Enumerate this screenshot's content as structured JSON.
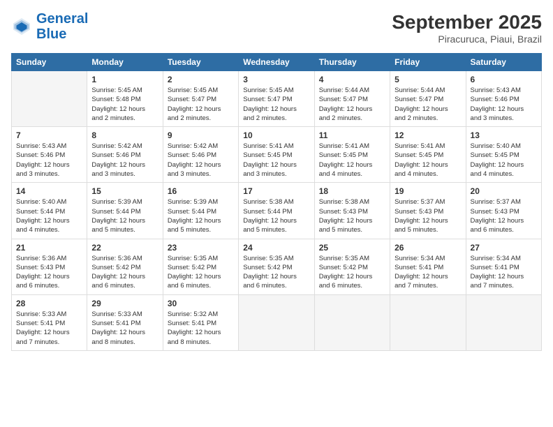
{
  "header": {
    "logo_line1": "General",
    "logo_line2": "Blue",
    "title": "September 2025",
    "subtitle": "Piracuruca, Piaui, Brazil"
  },
  "weekdays": [
    "Sunday",
    "Monday",
    "Tuesday",
    "Wednesday",
    "Thursday",
    "Friday",
    "Saturday"
  ],
  "weeks": [
    [
      {
        "day": "",
        "info": ""
      },
      {
        "day": "1",
        "info": "Sunrise: 5:45 AM\nSunset: 5:48 PM\nDaylight: 12 hours\nand 2 minutes."
      },
      {
        "day": "2",
        "info": "Sunrise: 5:45 AM\nSunset: 5:47 PM\nDaylight: 12 hours\nand 2 minutes."
      },
      {
        "day": "3",
        "info": "Sunrise: 5:45 AM\nSunset: 5:47 PM\nDaylight: 12 hours\nand 2 minutes."
      },
      {
        "day": "4",
        "info": "Sunrise: 5:44 AM\nSunset: 5:47 PM\nDaylight: 12 hours\nand 2 minutes."
      },
      {
        "day": "5",
        "info": "Sunrise: 5:44 AM\nSunset: 5:47 PM\nDaylight: 12 hours\nand 2 minutes."
      },
      {
        "day": "6",
        "info": "Sunrise: 5:43 AM\nSunset: 5:46 PM\nDaylight: 12 hours\nand 3 minutes."
      }
    ],
    [
      {
        "day": "7",
        "info": "Sunrise: 5:43 AM\nSunset: 5:46 PM\nDaylight: 12 hours\nand 3 minutes."
      },
      {
        "day": "8",
        "info": "Sunrise: 5:42 AM\nSunset: 5:46 PM\nDaylight: 12 hours\nand 3 minutes."
      },
      {
        "day": "9",
        "info": "Sunrise: 5:42 AM\nSunset: 5:46 PM\nDaylight: 12 hours\nand 3 minutes."
      },
      {
        "day": "10",
        "info": "Sunrise: 5:41 AM\nSunset: 5:45 PM\nDaylight: 12 hours\nand 3 minutes."
      },
      {
        "day": "11",
        "info": "Sunrise: 5:41 AM\nSunset: 5:45 PM\nDaylight: 12 hours\nand 4 minutes."
      },
      {
        "day": "12",
        "info": "Sunrise: 5:41 AM\nSunset: 5:45 PM\nDaylight: 12 hours\nand 4 minutes."
      },
      {
        "day": "13",
        "info": "Sunrise: 5:40 AM\nSunset: 5:45 PM\nDaylight: 12 hours\nand 4 minutes."
      }
    ],
    [
      {
        "day": "14",
        "info": "Sunrise: 5:40 AM\nSunset: 5:44 PM\nDaylight: 12 hours\nand 4 minutes."
      },
      {
        "day": "15",
        "info": "Sunrise: 5:39 AM\nSunset: 5:44 PM\nDaylight: 12 hours\nand 5 minutes."
      },
      {
        "day": "16",
        "info": "Sunrise: 5:39 AM\nSunset: 5:44 PM\nDaylight: 12 hours\nand 5 minutes."
      },
      {
        "day": "17",
        "info": "Sunrise: 5:38 AM\nSunset: 5:44 PM\nDaylight: 12 hours\nand 5 minutes."
      },
      {
        "day": "18",
        "info": "Sunrise: 5:38 AM\nSunset: 5:43 PM\nDaylight: 12 hours\nand 5 minutes."
      },
      {
        "day": "19",
        "info": "Sunrise: 5:37 AM\nSunset: 5:43 PM\nDaylight: 12 hours\nand 5 minutes."
      },
      {
        "day": "20",
        "info": "Sunrise: 5:37 AM\nSunset: 5:43 PM\nDaylight: 12 hours\nand 6 minutes."
      }
    ],
    [
      {
        "day": "21",
        "info": "Sunrise: 5:36 AM\nSunset: 5:43 PM\nDaylight: 12 hours\nand 6 minutes."
      },
      {
        "day": "22",
        "info": "Sunrise: 5:36 AM\nSunset: 5:42 PM\nDaylight: 12 hours\nand 6 minutes."
      },
      {
        "day": "23",
        "info": "Sunrise: 5:35 AM\nSunset: 5:42 PM\nDaylight: 12 hours\nand 6 minutes."
      },
      {
        "day": "24",
        "info": "Sunrise: 5:35 AM\nSunset: 5:42 PM\nDaylight: 12 hours\nand 6 minutes."
      },
      {
        "day": "25",
        "info": "Sunrise: 5:35 AM\nSunset: 5:42 PM\nDaylight: 12 hours\nand 6 minutes."
      },
      {
        "day": "26",
        "info": "Sunrise: 5:34 AM\nSunset: 5:41 PM\nDaylight: 12 hours\nand 7 minutes."
      },
      {
        "day": "27",
        "info": "Sunrise: 5:34 AM\nSunset: 5:41 PM\nDaylight: 12 hours\nand 7 minutes."
      }
    ],
    [
      {
        "day": "28",
        "info": "Sunrise: 5:33 AM\nSunset: 5:41 PM\nDaylight: 12 hours\nand 7 minutes."
      },
      {
        "day": "29",
        "info": "Sunrise: 5:33 AM\nSunset: 5:41 PM\nDaylight: 12 hours\nand 8 minutes."
      },
      {
        "day": "30",
        "info": "Sunrise: 5:32 AM\nSunset: 5:41 PM\nDaylight: 12 hours\nand 8 minutes."
      },
      {
        "day": "",
        "info": ""
      },
      {
        "day": "",
        "info": ""
      },
      {
        "day": "",
        "info": ""
      },
      {
        "day": "",
        "info": ""
      }
    ]
  ]
}
